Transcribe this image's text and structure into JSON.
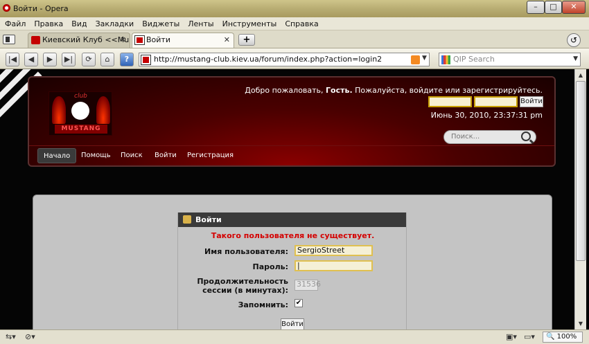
{
  "window": {
    "title": "Войти - Opera",
    "min": "–",
    "max": "□",
    "close": "✕"
  },
  "menu": [
    "Файл",
    "Правка",
    "Вид",
    "Закладки",
    "Виджеты",
    "Ленты",
    "Инструменты",
    "Справка"
  ],
  "tabs": [
    {
      "label": "Киевский Клуб <<Mu...",
      "close": "✕"
    },
    {
      "label": "Войти",
      "close": "✕"
    }
  ],
  "new_tab": "+",
  "nav": {
    "address": "http://mustang-club.kiev.ua/forum/index.php?action=login2",
    "search_placeholder": "QIP Search",
    "buttons": {
      "first": "|◀",
      "back": "◀",
      "forward": "▶",
      "last": "▶|",
      "reload": "⟳",
      "home": "⌂",
      "key": "?"
    }
  },
  "site": {
    "logo_club": "club",
    "logo_name": "MUSTANG",
    "welcome_prefix": "Добро пожаловать,",
    "welcome_guest": "Гость.",
    "welcome_suffix": "Пожалуйста, войдите или зарегистрируйтесь.",
    "mini_login_button": "Войти",
    "datetime": "Июнь 30, 2010, 23:37:31 pm",
    "search_placeholder": "Поиск...",
    "nav": [
      "Начало",
      "Помощь",
      "Поиск",
      "Войти",
      "Регистрация"
    ]
  },
  "login": {
    "title": "Войти",
    "error": "Такого пользователя не существует.",
    "username_label": "Имя пользователя:",
    "username_value": "SergioStreet",
    "password_label": "Пароль:",
    "password_value": "|",
    "session_label_1": "Продолжительность",
    "session_label_2": "сессии (в минутах):",
    "session_value": "31536",
    "remember_label": "Запомнить:",
    "remember_checked": "✔",
    "submit": "Войти"
  },
  "status": {
    "zoom": "100%"
  },
  "colors": {
    "error": "#d40000",
    "accent": "#8a0000",
    "input_border": "#e0c050"
  }
}
